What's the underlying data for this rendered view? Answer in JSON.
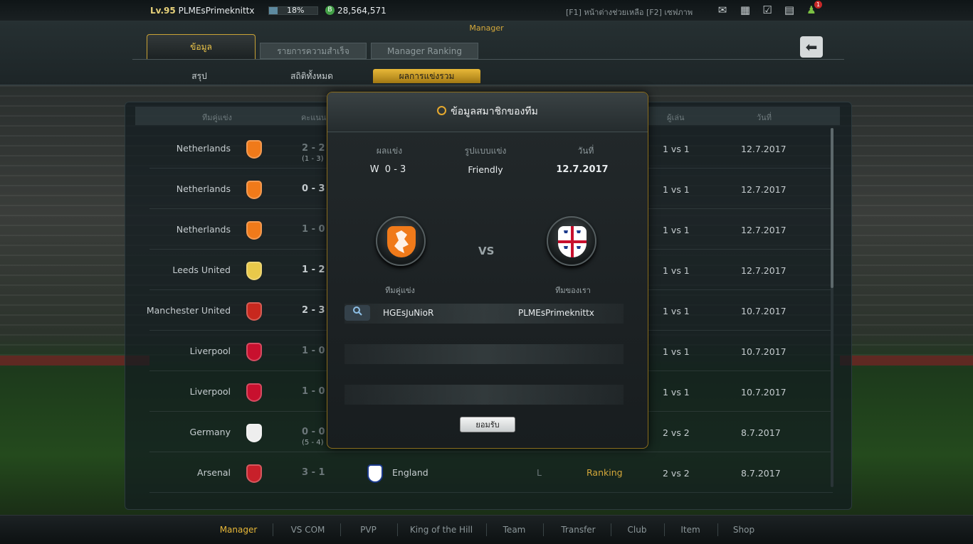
{
  "topbar": {
    "level": "Lv.95",
    "username": "PLMEsPrimeknittx",
    "xp_percent_label": "18%",
    "xp_fraction": 0.18,
    "currency": "28,564,571",
    "coin_glyph": "B",
    "hint": "[F1] หน้าต่างช่วยเหลือ [F2] เซฟภาพ",
    "notification_count": "1",
    "icons": [
      "mail-icon",
      "profile-card-icon",
      "calendar-check-icon",
      "chat-icon",
      "friends-icon"
    ]
  },
  "section_label": "Manager",
  "tabs": [
    {
      "label": "ข้อมูล",
      "active": true
    },
    {
      "label": "รายการความสำเร็จ",
      "active": false
    },
    {
      "label": "Manager Ranking",
      "active": false
    }
  ],
  "subtabs": [
    {
      "label": "สรุป",
      "active": false
    },
    {
      "label": "สถิติทั้งหมด",
      "active": false
    },
    {
      "label": "ผลการแข่งรวม",
      "active": true
    }
  ],
  "list": {
    "headers": {
      "opponent": "ทีมคู่แข่ง",
      "score": "คะแนน",
      "players": "ผู้เล่น",
      "date": "วันที่"
    },
    "rows": [
      {
        "team": "Netherlands",
        "score": "2 - 2",
        "sub": "(1 - 3)",
        "dim": true,
        "players": "1 vs 1",
        "date": "12.7.2017"
      },
      {
        "team": "Netherlands",
        "score": "0 - 3",
        "sub": "",
        "dim": false,
        "players": "1 vs 1",
        "date": "12.7.2017"
      },
      {
        "team": "Netherlands",
        "score": "1 - 0",
        "sub": "",
        "dim": true,
        "players": "1 vs 1",
        "date": "12.7.2017"
      },
      {
        "team": "Leeds United",
        "score": "1 - 2",
        "sub": "",
        "dim": false,
        "players": "1 vs 1",
        "date": "12.7.2017"
      },
      {
        "team": "Manchester United",
        "score": "2 - 3",
        "sub": "",
        "dim": false,
        "players": "1 vs 1",
        "date": "10.7.2017"
      },
      {
        "team": "Liverpool",
        "score": "1 - 0",
        "sub": "",
        "dim": true,
        "players": "1 vs 1",
        "date": "10.7.2017"
      },
      {
        "team": "Liverpool",
        "score": "1 - 0",
        "sub": "",
        "dim": true,
        "players": "1 vs 1",
        "date": "10.7.2017"
      },
      {
        "team": "Germany",
        "score": "0 - 0",
        "sub": "(5 - 4)",
        "dim": true,
        "players": "2 vs 2",
        "date": "8.7.2017"
      },
      {
        "team": "Arsenal",
        "score": "3 - 1",
        "sub": "",
        "dim": true,
        "players": "2 vs 2",
        "date": "8.7.2017",
        "own_team": "England",
        "result": "L",
        "mode": "Ranking"
      }
    ]
  },
  "modal": {
    "title": "ข้อมูลสมาชิกของทีม",
    "result_header": "ผลแข่ง",
    "result_value": "W  0 - 3",
    "mode_header": "รูปแบบแข่ง",
    "mode_value": "Friendly",
    "date_header": "วันที่",
    "date_value": "12.7.2017",
    "vs_label": "VS",
    "opponent_caption": "ทีมคู่แข่ง",
    "own_caption": "ทีมของเรา",
    "opponent_player": "HGEsJuNioR",
    "own_player": "PLMEsPrimeknittx",
    "ok_label": "ยอมรับ"
  },
  "bottom_nav": [
    {
      "label": "Manager",
      "active": true
    },
    {
      "label": "VS COM",
      "active": false
    },
    {
      "label": "PVP",
      "active": false
    },
    {
      "label": "King of the Hill",
      "active": false
    },
    {
      "label": "Team",
      "active": false
    },
    {
      "label": "Transfer",
      "active": false
    },
    {
      "label": "Club",
      "active": false
    },
    {
      "label": "Item",
      "active": false
    },
    {
      "label": "Shop",
      "active": false
    }
  ],
  "colors": {
    "accent": "#e8b838",
    "netherlands": "#f07a1a",
    "england_red": "#c8102e"
  }
}
